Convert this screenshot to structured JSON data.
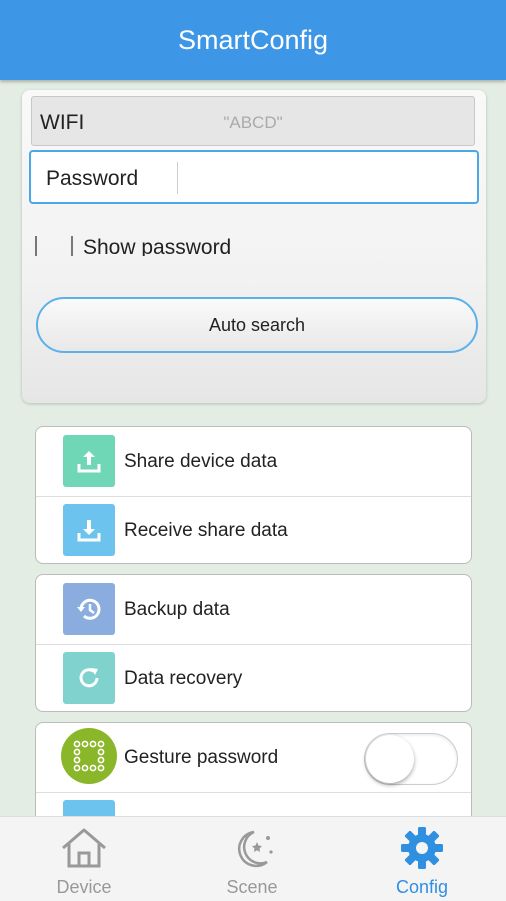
{
  "header": {
    "title": "SmartConfig"
  },
  "wifi": {
    "label": "WIFI",
    "ssid": "\"ABCD\""
  },
  "password": {
    "label": "Password",
    "value": ""
  },
  "show_password": {
    "label": "Show password",
    "checked": false
  },
  "auto_search": {
    "label": "Auto search"
  },
  "groups": [
    {
      "items": [
        {
          "label": "Share device data",
          "icon": "upload-icon",
          "color": "#6fd6b6"
        },
        {
          "label": "Receive share data",
          "icon": "download-icon",
          "color": "#6cc3ee"
        }
      ]
    },
    {
      "items": [
        {
          "label": "Backup data",
          "icon": "history-icon",
          "color": "#8aacdf"
        },
        {
          "label": "Data recovery",
          "icon": "refresh-icon",
          "color": "#7fd2cd"
        }
      ]
    },
    {
      "items": [
        {
          "label": "Gesture password",
          "icon": "gesture-grid-icon",
          "color": "#8ab629",
          "toggle_on": false
        }
      ]
    }
  ],
  "tabs": [
    {
      "label": "Device",
      "icon": "home-icon",
      "active": false
    },
    {
      "label": "Scene",
      "icon": "moon-stars-icon",
      "active": false
    },
    {
      "label": "Config",
      "icon": "gear-icon",
      "active": true
    }
  ],
  "colors": {
    "header": "#3d96e6",
    "accent": "#2f8fe0",
    "tab_inactive": "#999999",
    "background": "#e3ede3"
  }
}
